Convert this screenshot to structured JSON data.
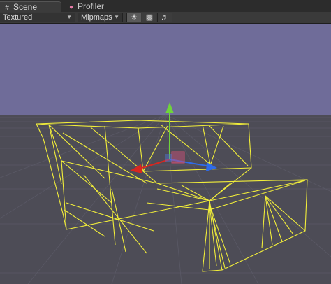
{
  "tabs": {
    "scene_label": "Scene",
    "scene_icon": "grid-icon",
    "profiler_label": "Profiler",
    "profiler_icon": "profiler-icon"
  },
  "toolbar": {
    "render_mode": "Textured",
    "texture_mode": "Mipmaps",
    "lighting_icon": "sun-icon",
    "effects_icon": "image-icon",
    "audio_icon": "speaker-icon"
  },
  "scene": {
    "sky_color": "#6f6c99",
    "ground_color": "#4d4c56",
    "wireframe_color": "#f2ee3a",
    "gizmo_x_color": "#d8261f",
    "gizmo_y_color": "#6fd43a",
    "gizmo_z_color": "#2f6be8"
  }
}
